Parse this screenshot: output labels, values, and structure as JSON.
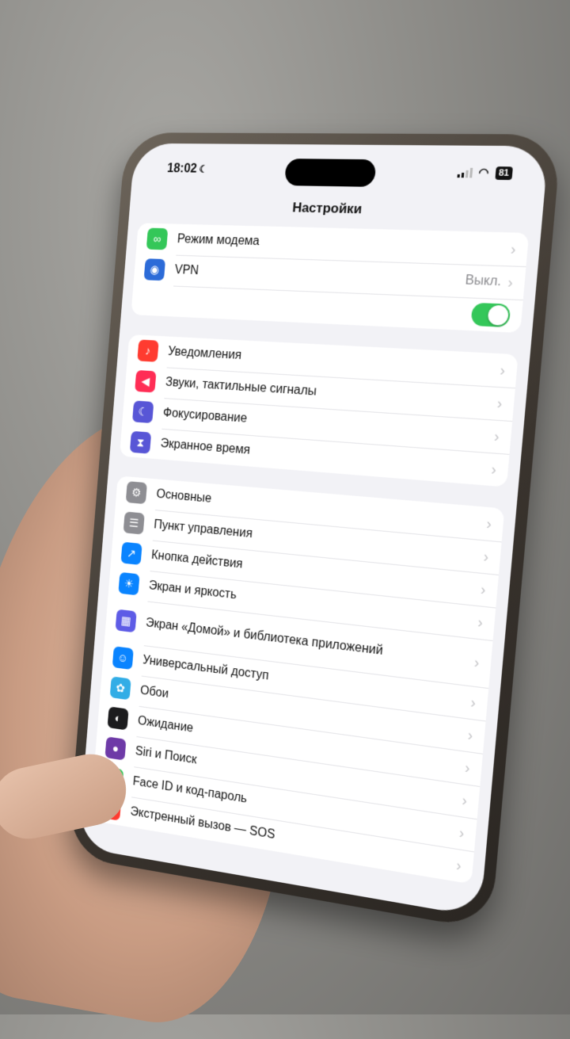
{
  "status": {
    "time": "18:02",
    "battery": "81"
  },
  "nav": {
    "title": "Настройки"
  },
  "group1": [
    {
      "label": "Режим модема",
      "icon": "link-icon",
      "color": "#34c759",
      "glyph": "∞"
    },
    {
      "label": "VPN",
      "icon": "globe-icon",
      "color": "#2c6bd8",
      "glyph": "◉",
      "value": "Выкл."
    }
  ],
  "group2": [
    {
      "label": "Уведомления",
      "icon": "bell-icon",
      "color": "#ff3b30",
      "glyph": "♪"
    },
    {
      "label": "Звуки, тактильные сигналы",
      "icon": "speaker-icon",
      "color": "#ff2d55",
      "glyph": "◀"
    },
    {
      "label": "Фокусирование",
      "icon": "moon-icon",
      "color": "#5856d6",
      "glyph": "☾"
    },
    {
      "label": "Экранное время",
      "icon": "hourglass-icon",
      "color": "#5856d6",
      "glyph": "⧗"
    }
  ],
  "group3": [
    {
      "label": "Основные",
      "icon": "gear-icon",
      "color": "#8e8e93",
      "glyph": "⚙"
    },
    {
      "label": "Пункт управления",
      "icon": "switches-icon",
      "color": "#8e8e93",
      "glyph": "☰"
    },
    {
      "label": "Кнопка действия",
      "icon": "action-button-icon",
      "color": "#0a84ff",
      "glyph": "↗"
    },
    {
      "label": "Экран и яркость",
      "icon": "sun-icon",
      "color": "#0a84ff",
      "glyph": "☀"
    },
    {
      "label": "Экран «Домой» и библиотека приложений",
      "icon": "home-grid-icon",
      "color": "#5e5ce6",
      "glyph": "▦"
    },
    {
      "label": "Универсальный доступ",
      "icon": "accessibility-icon",
      "color": "#0a84ff",
      "glyph": "☺"
    },
    {
      "label": "Обои",
      "icon": "flower-icon",
      "color": "#32ade6",
      "glyph": "✿"
    },
    {
      "label": "Ожидание",
      "icon": "standby-icon",
      "color": "#1c1c1e",
      "glyph": "◐"
    },
    {
      "label": "Siri и Поиск",
      "icon": "siri-icon",
      "color": "#6e3aa7",
      "glyph": "●"
    },
    {
      "label": "Face ID и код-пароль",
      "icon": "faceid-icon",
      "color": "#34c759",
      "glyph": "☻"
    },
    {
      "label": "Экстренный вызов — SOS",
      "icon": "sos-icon",
      "color": "#ff3b30",
      "glyph": "SOS"
    }
  ],
  "chevron": "›"
}
